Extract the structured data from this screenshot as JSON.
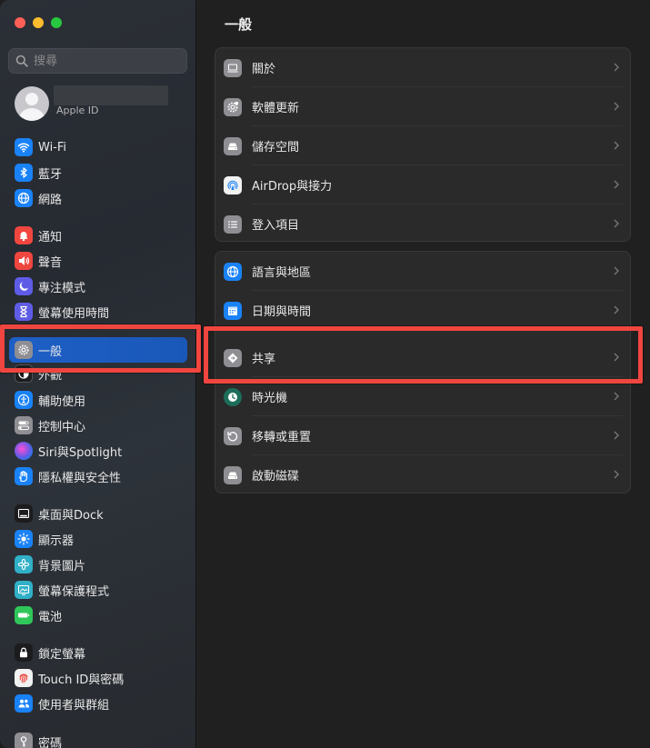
{
  "sidebar": {
    "search_placeholder": "搜尋",
    "apple_id_label": "Apple ID",
    "items": [
      {
        "label": "Wi-Fi",
        "icon": "wifi-icon",
        "color": "#1a82f7"
      },
      {
        "label": "藍牙",
        "icon": "bluetooth-icon",
        "color": "#1a82f7"
      },
      {
        "label": "網路",
        "icon": "globe-icon",
        "color": "#1a82f7"
      },
      {
        "label": "通知",
        "icon": "bell-icon",
        "color": "#f0463f"
      },
      {
        "label": "聲音",
        "icon": "speaker-icon",
        "color": "#f0463f"
      },
      {
        "label": "專注模式",
        "icon": "moon-icon",
        "color": "#5e5ce6"
      },
      {
        "label": "螢幕使用時間",
        "icon": "hourglass-icon",
        "color": "#5e5ce6"
      },
      {
        "label": "一般",
        "icon": "gear-icon",
        "color": "#8e8e93"
      },
      {
        "label": "外觀",
        "icon": "appearance-icon",
        "color": "#1c1c1e"
      },
      {
        "label": "輔助使用",
        "icon": "accessibility-icon",
        "color": "#1a82f7"
      },
      {
        "label": "控制中心",
        "icon": "control-center-icon",
        "color": "#8e8e93"
      },
      {
        "label": "Siri與Spotlight",
        "icon": "siri-icon",
        "color": "#bf5af2"
      },
      {
        "label": "隱私權與安全性",
        "icon": "hand-icon",
        "color": "#1a82f7"
      },
      {
        "label": "桌面與Dock",
        "icon": "dock-icon",
        "color": "#1c1c1e"
      },
      {
        "label": "顯示器",
        "icon": "sun-icon",
        "color": "#1a82f7"
      },
      {
        "label": "背景圖片",
        "icon": "flower-icon",
        "color": "#30b0c7"
      },
      {
        "label": "螢幕保護程式",
        "icon": "screensaver-icon",
        "color": "#30b0c7"
      },
      {
        "label": "電池",
        "icon": "battery-icon",
        "color": "#30c75a"
      },
      {
        "label": "鎖定螢幕",
        "icon": "lock-icon",
        "color": "#1c1c1e"
      },
      {
        "label": "Touch ID與密碼",
        "icon": "fingerprint-icon",
        "color": "#f2f2f2"
      },
      {
        "label": "使用者與群組",
        "icon": "users-icon",
        "color": "#1a82f7"
      },
      {
        "label": "密碼",
        "icon": "key-icon",
        "color": "#8e8e93"
      }
    ]
  },
  "main": {
    "title": "一般",
    "group1": [
      {
        "label": "關於",
        "icon": "laptop-icon"
      },
      {
        "label": "軟體更新",
        "icon": "gear-badge-icon"
      },
      {
        "label": "儲存空間",
        "icon": "disk-icon"
      },
      {
        "label": "AirDrop與接力",
        "icon": "airdrop-icon"
      },
      {
        "label": "登入項目",
        "icon": "list-icon"
      }
    ],
    "group2": [
      {
        "label": "語言與地區",
        "icon": "globe-icon"
      },
      {
        "label": "日期與時間",
        "icon": "calendar-icon"
      },
      {
        "label": "共享",
        "icon": "sharing-icon"
      },
      {
        "label": "時光機",
        "icon": "time-machine-icon"
      },
      {
        "label": "移轉或重置",
        "icon": "reset-icon"
      },
      {
        "label": "啟動磁碟",
        "icon": "startup-disk-icon"
      }
    ]
  },
  "highlight_color": "#f0463f"
}
